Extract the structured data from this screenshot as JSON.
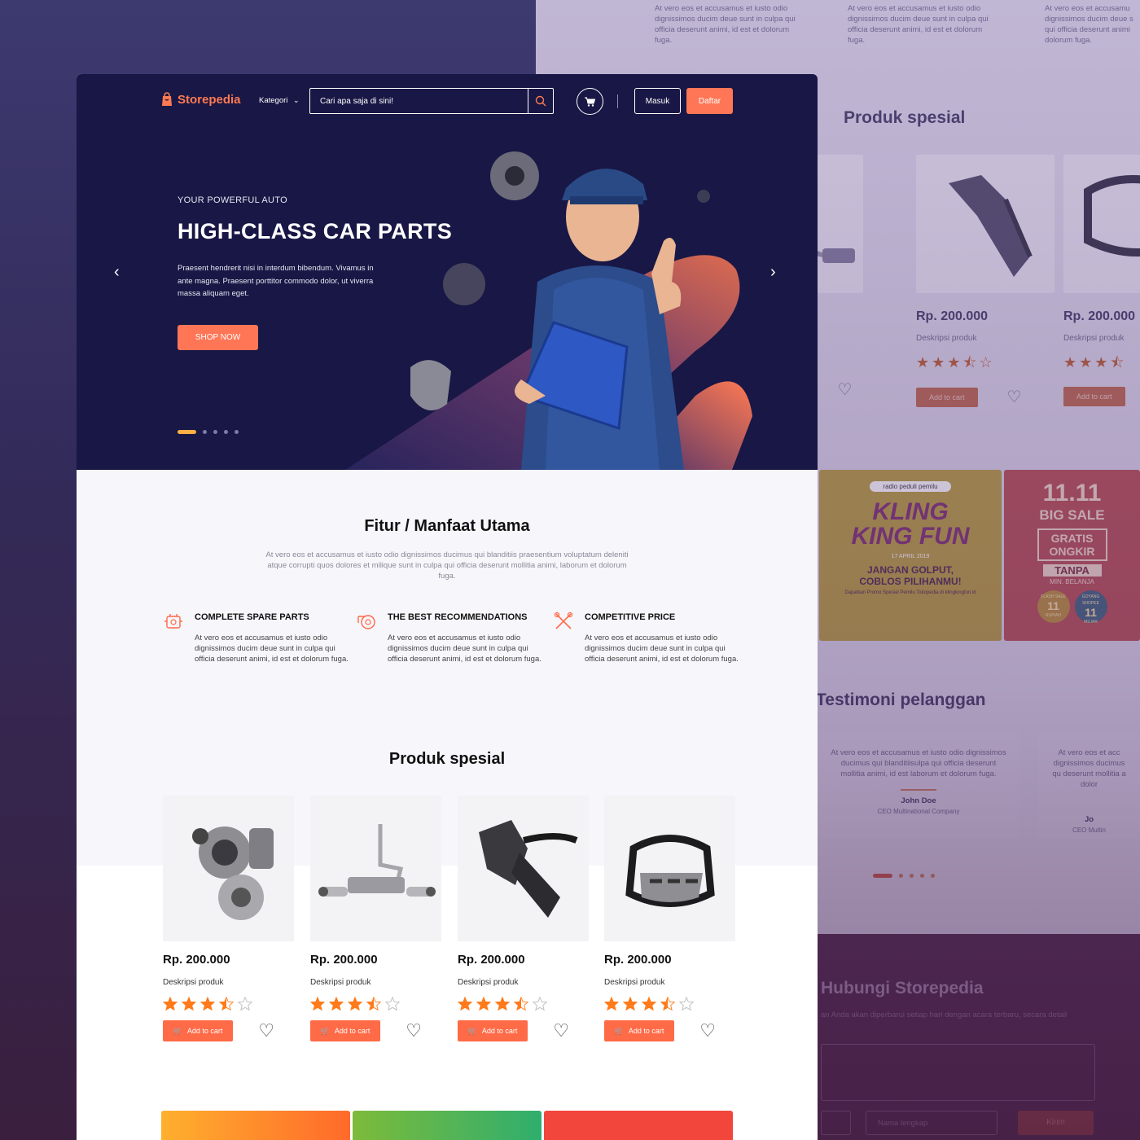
{
  "brand": {
    "name": "Storepedia",
    "accent": "#ff7656",
    "hero_bg": "#181745"
  },
  "header": {
    "category_label": "Kategori",
    "search_placeholder": "Cari apa saja di sini!",
    "login_label": "Masuk",
    "register_label": "Daftar"
  },
  "hero": {
    "eyebrow": "YOUR POWERFUL AUTO",
    "title": "HIGH-CLASS CAR PARTS",
    "description": "Praesent hendrerit nisi in interdum bibendum. Vivamus in ante magna. Praesent porttitor commodo dolor, ut viverra massa aliquam eget.",
    "cta": "SHOP NOW",
    "slides": 5,
    "active_slide": 1,
    "watermark": "a"
  },
  "features": {
    "title": "Fitur / Manfaat Utama",
    "subtitle": "At vero eos et accusamus et iusto odio dignissimos ducimus qui blanditiis praesentium voluptatum deleniti atque corrupti quos dolores et milique sunt in culpa qui officia deserunt mollitia animi, laborum et dolorum fuga.",
    "items": [
      {
        "title": "COMPLETE SPARE PARTS",
        "icon": "engine-icon",
        "text": "At vero eos et accusamus et iusto odio dignissimos ducim deue sunt in culpa qui officia deserunt  animi, id est  et dolorum fuga."
      },
      {
        "title": "THE BEST RECOMMENDATIONS",
        "icon": "turbo-icon",
        "text": "At vero eos et accusamus et iusto odio dignissimos ducim deue sunt in culpa qui officia deserunt  animi, id est  et dolorum fuga."
      },
      {
        "title": "COMPETITIVE PRICE",
        "icon": "tools-icon",
        "text": "At vero eos et accusamus et iusto odio dignissimos ducim deue sunt in culpa qui officia deserunt  animi, id est  et dolorum fuga."
      }
    ]
  },
  "products": {
    "title": "Produk spesial",
    "add_to_cart": "Add to cart",
    "items": [
      {
        "price": "Rp. 200.000",
        "desc": "Deskripsi produk",
        "rating": 3.5,
        "image": "turbocharger"
      },
      {
        "price": "Rp. 200.000",
        "desc": "Deskripsi produk",
        "rating": 3.5,
        "image": "exhaust"
      },
      {
        "price": "Rp. 200.000",
        "desc": "Deskripsi produk",
        "rating": 3.5,
        "image": "air-intake"
      },
      {
        "price": "Rp. 200.000",
        "desc": "Deskripsi produk",
        "rating": 3.5,
        "image": "bull-bar"
      }
    ]
  },
  "background_page": {
    "top_text": "At vero eos et accusamus et iusto odio dignissimos ducim deue sunt in culpa qui officia deserunt  animi, id est  et dolorum fuga.",
    "top_text_partial": "At vero eos et accusamu dignissimos ducim deue s qui officia deserunt  animi dolorum fuga.",
    "products_title": "Produk spesial",
    "product_price": "Rp. 200.000",
    "product_price_partial": ".000",
    "product_desc": "Deskripsi produk",
    "product_desc_partial": "duk",
    "add_to_cart": "Add to cart",
    "add_to_cart_partial": "art",
    "banner1": {
      "badge": "radio peduli pemilu",
      "title": "KLING KING FUN",
      "date": "17 APRIL 2019",
      "tagline": "JANGAN GOLPUT, COBLOS PILIHANMU!",
      "foot": "Dapatkan Promo Spesial Pemilu Tokopedia di klingkingfun.id"
    },
    "banner2": {
      "title": "11.11",
      "subtitle": "BIG SALE",
      "promo": "GRATIS ONGKIR",
      "promo2": "TANPA",
      "promo3": "MIN. BELANJA",
      "badge1": "11",
      "badge1_top": "FLASH SALE",
      "badge1_bottom": "RUPIAH",
      "badge2": "11",
      "badge2_top": "GOYANG SHOPEE",
      "badge2_bottom": "MILIAR"
    },
    "testimonials_title": "Testimoni pelanggan",
    "testimonial_text": "At vero eos et accusamus et iusto odio dignissimos ducimus qui blanditiisulpa qui officia deserunt mollitia animi, id est laborum et dolorum fuga.",
    "testimonial_text_partial": "At vero eos et acc dignissimos ducimus qu deserunt mollitia a dolor",
    "testimonial_name": "John Doe",
    "testimonial_name_partial": "Jo",
    "testimonial_role": "CEO Multinational Company",
    "testimonial_role_partial": "CEO Multin",
    "contact_title": "Hubungi Storepedia",
    "contact_sub": "an Anda akan diperbarui setiap hari dengan acara terbaru, secara detail",
    "name_placeholder": "Nama lengkap",
    "send_label": "Kirim"
  }
}
